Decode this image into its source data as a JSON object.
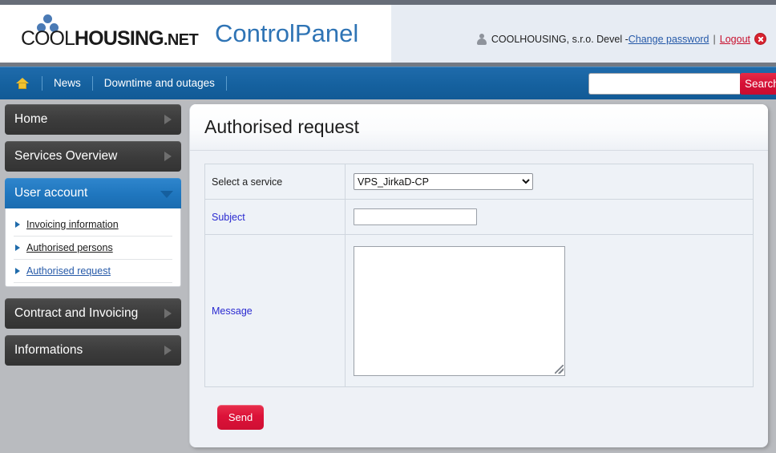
{
  "header": {
    "logo": {
      "word_cool": "COOL",
      "word_housing": "HOUSING",
      "word_net": ".NET",
      "dots_icon": "three-dots-icon"
    },
    "app_title": "ControlPanel",
    "user": {
      "user_icon": "user-icon",
      "account_name": "COOLHOUSING, s.r.o. Devel -",
      "change_password_label": "Change password",
      "separator": "|",
      "logout_label": "Logout",
      "logout_icon": "logout-circle-x-icon"
    }
  },
  "navbar": {
    "home_icon": "home-icon",
    "items": [
      {
        "label": "News"
      },
      {
        "label": "Downtime and outages"
      }
    ],
    "search": {
      "value": "",
      "placeholder": "",
      "button_label": "Search"
    }
  },
  "sidebar": {
    "items": [
      {
        "label": "Home",
        "icon": "chevron-right-icon",
        "active": false
      },
      {
        "label": "Services Overview",
        "icon": "chevron-right-icon",
        "active": false
      },
      {
        "label": "User account",
        "icon": "chevron-down-icon",
        "active": true
      },
      {
        "label": "Contract and Invoicing",
        "icon": "chevron-right-icon",
        "active": false
      },
      {
        "label": "Informations",
        "icon": "chevron-right-icon",
        "active": false
      }
    ],
    "submenu": [
      {
        "label": "Invoicing information",
        "active": false
      },
      {
        "label": "Authorised persons",
        "active": false
      },
      {
        "label": "Authorised request",
        "active": true
      }
    ]
  },
  "main": {
    "page_title": "Authorised request",
    "form": {
      "service_row": {
        "label": "Select a service",
        "selected": "VPS_JirkaD-CP",
        "options": [
          "VPS_JirkaD-CP"
        ]
      },
      "subject_row": {
        "label": "Subject",
        "value": "",
        "placeholder": ""
      },
      "message_row": {
        "label": "Message",
        "value": "",
        "placeholder": ""
      },
      "send_label": "Send"
    }
  },
  "colors": {
    "brand_blue": "#2f74b5",
    "nav_blue": "#15619f",
    "accent_red": "#d61036",
    "sidebar_dark": "#3c3c3c",
    "sidebar_active": "#1f76be",
    "label_blue": "#2a2ad0",
    "link_blue": "#2559a8",
    "link_red": "#c8102e"
  }
}
